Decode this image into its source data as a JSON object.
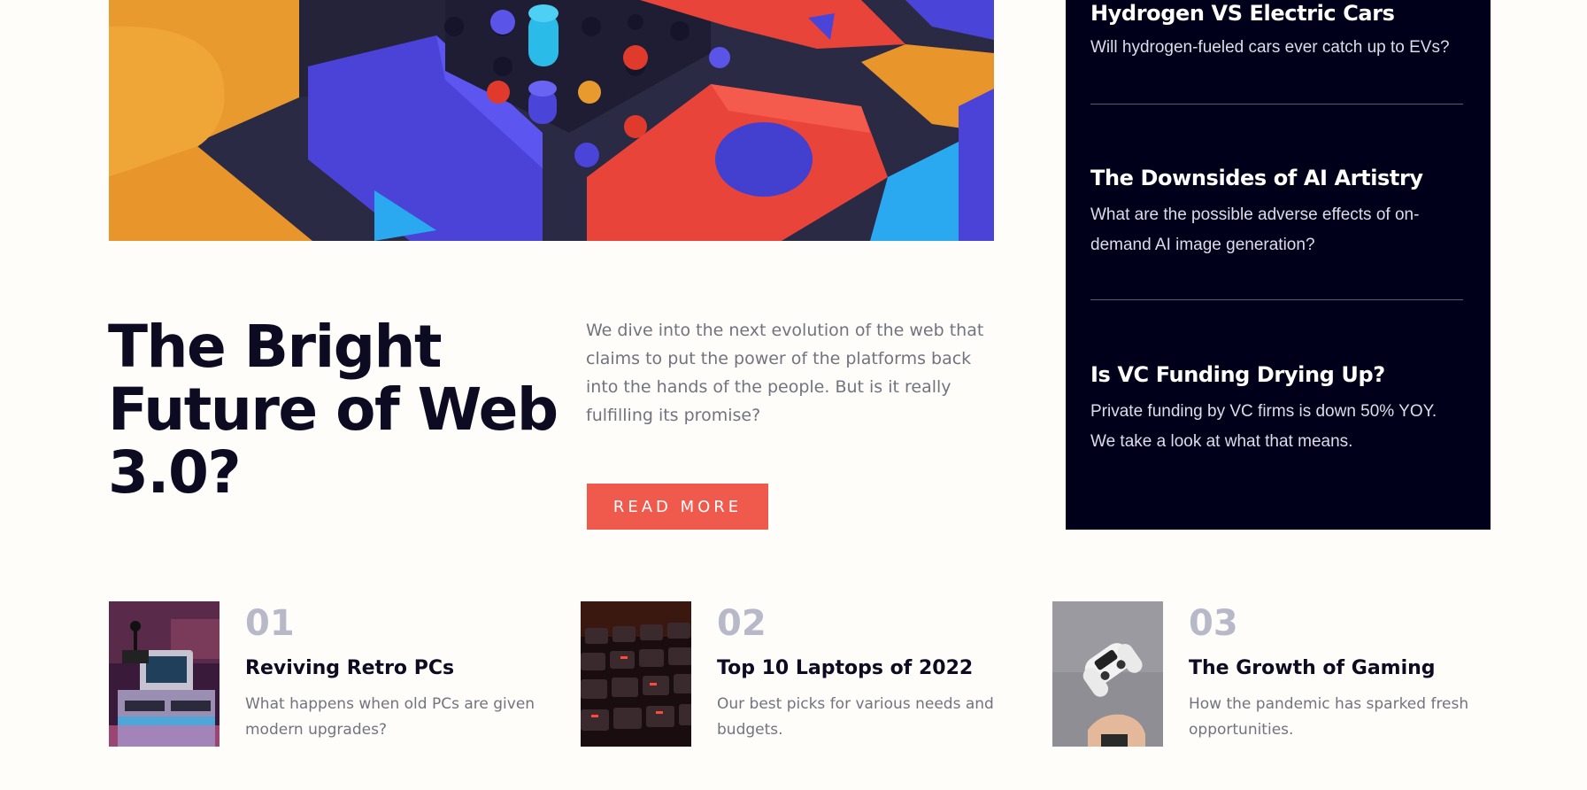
{
  "hero": {
    "image_icon": "abstract-3d-shapes-image",
    "title": "The Bright Future of Web 3.0?",
    "description": "We dive into the next evolution of the web that claims to put the power of the platforms back into the hands of the people. But is it really fulfilling its promise?",
    "cta_label": "READ MORE",
    "accent_color": "#f05a4d",
    "title_color": "#0d0b21"
  },
  "sidebar": {
    "background_color": "#00001a",
    "items": [
      {
        "title": "Hydrogen VS Electric Cars",
        "description": "Will hydrogen-fueled cars ever catch up to EVs?"
      },
      {
        "title": "The Downsides of AI Artistry",
        "description": "What are the possible adverse effects of on-demand AI image generation?"
      },
      {
        "title": "Is VC Funding Drying Up?",
        "description": "Private funding by VC firms is down 50% YOY. We take a look at what that means."
      }
    ]
  },
  "cards": [
    {
      "number": "01",
      "title": "Reviving Retro PCs",
      "description": "What happens when old PCs are given modern upgrades?",
      "image_icon": "retro-computer-image"
    },
    {
      "number": "02",
      "title": "Top 10 Laptops of 2022",
      "description": "Our best picks for various needs and budgets.",
      "image_icon": "laptop-keyboard-image"
    },
    {
      "number": "03",
      "title": "The Growth of Gaming",
      "description": "How the pandemic has sparked fresh opportunities.",
      "image_icon": "game-controller-image"
    }
  ]
}
